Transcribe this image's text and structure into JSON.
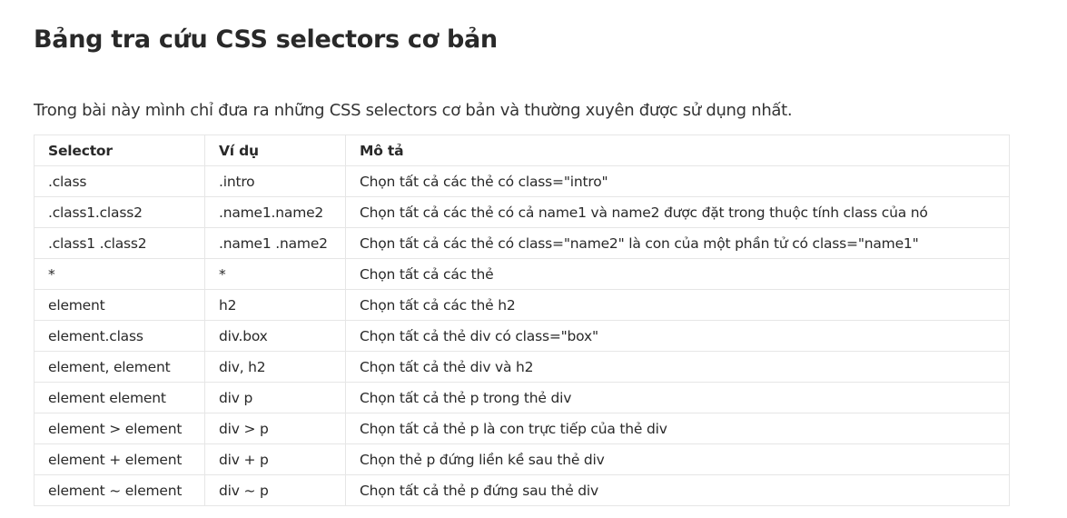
{
  "title": "Bảng tra cứu CSS selectors cơ bản",
  "intro": "Trong bài này mình chỉ đưa ra những CSS selectors cơ bản và thường xuyên được sử dụng nhất.",
  "table": {
    "headers": [
      "Selector",
      "Ví dụ",
      "Mô tả"
    ],
    "rows": [
      [
        ".class",
        ".intro",
        "Chọn tất cả các thẻ có class=\"intro\""
      ],
      [
        ".class1.class2",
        ".name1.name2",
        "Chọn tất cả các thẻ có cả name1 và name2 được đặt trong thuộc tính class của nó"
      ],
      [
        ".class1 .class2",
        ".name1 .name2",
        "Chọn tất cả các thẻ có class=\"name2\" là con của một phần tử có class=\"name1\""
      ],
      [
        "*",
        "*",
        "Chọn tất cả các thẻ"
      ],
      [
        "element",
        "h2",
        "Chọn tất cả các thẻ h2"
      ],
      [
        "element.class",
        "div.box",
        "Chọn tất cả thẻ div có class=\"box\""
      ],
      [
        "element, element",
        "div, h2",
        "Chọn tất cả thẻ div và h2"
      ],
      [
        "element element",
        "div p",
        "Chọn tất cả thẻ p trong thẻ div"
      ],
      [
        "element > element",
        "div > p",
        "Chọn tất cả thẻ p là con trực tiếp của thẻ div"
      ],
      [
        "element + element",
        "div + p",
        "Chọn thẻ p đứng liền kề sau thẻ div"
      ],
      [
        "element ~ element",
        "div ~ p",
        "Chọn tất cả thẻ p đứng sau thẻ div"
      ]
    ]
  }
}
